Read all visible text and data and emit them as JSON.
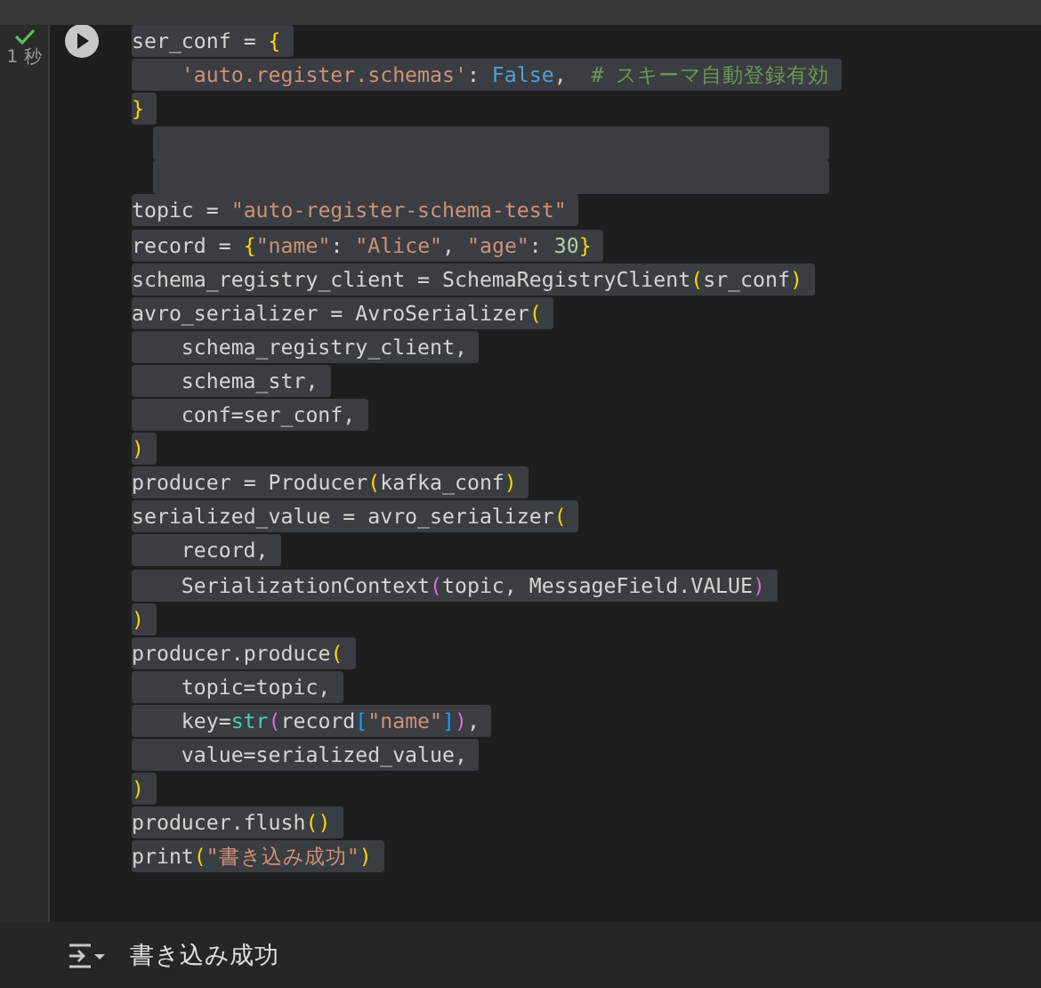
{
  "cell": {
    "status": {
      "done": true,
      "time": "1 秒"
    },
    "lines": [
      {
        "tokens": [
          {
            "text": "ser_conf = ",
            "kind": "plain"
          },
          {
            "text": "{",
            "kind": "brace"
          }
        ]
      },
      {
        "indented": true,
        "tokens": [
          {
            "text": "'auto.register.schemas'",
            "kind": "string"
          },
          {
            "text": ": ",
            "kind": "plain"
          },
          {
            "text": "False",
            "kind": "keyword"
          },
          {
            "text": ",  ",
            "kind": "plain"
          },
          {
            "text": "# スキーマ自動登録有効",
            "kind": "comment"
          }
        ]
      },
      {
        "tokens": [
          {
            "text": "}",
            "kind": "brace"
          }
        ]
      },
      {
        "kind": "blank"
      },
      {
        "kind": "blank"
      },
      {
        "tokens": [
          {
            "text": "topic = ",
            "kind": "plain"
          },
          {
            "text": "\"auto-register-schema-test\"",
            "kind": "string"
          }
        ]
      },
      {
        "tokens": [
          {
            "text": "record = ",
            "kind": "plain"
          },
          {
            "text": "{",
            "kind": "brace"
          },
          {
            "text": "\"name\"",
            "kind": "string"
          },
          {
            "text": ": ",
            "kind": "plain"
          },
          {
            "text": "\"Alice\"",
            "kind": "string"
          },
          {
            "text": ", ",
            "kind": "plain"
          },
          {
            "text": "\"age\"",
            "kind": "string"
          },
          {
            "text": ": ",
            "kind": "plain"
          },
          {
            "text": "30",
            "kind": "number"
          },
          {
            "text": "}",
            "kind": "brace"
          }
        ]
      },
      {
        "tokens": [
          {
            "text": "schema_registry_client = SchemaRegistryClient",
            "kind": "plain"
          },
          {
            "text": "(",
            "kind": "brace"
          },
          {
            "text": "sr_conf",
            "kind": "plain"
          },
          {
            "text": ")",
            "kind": "brace"
          }
        ]
      },
      {
        "tokens": [
          {
            "text": "avro_serializer = AvroSerializer",
            "kind": "plain"
          },
          {
            "text": "(",
            "kind": "brace"
          }
        ]
      },
      {
        "indented": true,
        "tokens": [
          {
            "text": "schema_registry_client,",
            "kind": "plain"
          }
        ]
      },
      {
        "indented": true,
        "tokens": [
          {
            "text": "schema_str,",
            "kind": "plain"
          }
        ]
      },
      {
        "indented": true,
        "tokens": [
          {
            "text": "conf=ser_conf,",
            "kind": "plain"
          }
        ]
      },
      {
        "tokens": [
          {
            "text": ")",
            "kind": "brace"
          }
        ]
      },
      {
        "tokens": [
          {
            "text": "producer = Producer",
            "kind": "plain"
          },
          {
            "text": "(",
            "kind": "brace"
          },
          {
            "text": "kafka_conf",
            "kind": "plain"
          },
          {
            "text": ")",
            "kind": "brace"
          }
        ]
      },
      {
        "tokens": [
          {
            "text": "serialized_value = avro_serializer",
            "kind": "plain"
          },
          {
            "text": "(",
            "kind": "brace"
          }
        ]
      },
      {
        "indented": true,
        "tokens": [
          {
            "text": "record,",
            "kind": "plain"
          }
        ]
      },
      {
        "indented": true,
        "tokens": [
          {
            "text": "SerializationContext",
            "kind": "plain"
          },
          {
            "text": "(",
            "kind": "paren2"
          },
          {
            "text": "topic, MessageField.VALUE",
            "kind": "plain"
          },
          {
            "text": ")",
            "kind": "paren2"
          }
        ]
      },
      {
        "tokens": [
          {
            "text": ")",
            "kind": "brace"
          }
        ]
      },
      {
        "tokens": [
          {
            "text": "producer.produce",
            "kind": "plain"
          },
          {
            "text": "(",
            "kind": "brace"
          }
        ]
      },
      {
        "indented": true,
        "tokens": [
          {
            "text": "topic=topic,",
            "kind": "plain"
          }
        ]
      },
      {
        "indented": true,
        "tokens": [
          {
            "text": "key=",
            "kind": "plain"
          },
          {
            "text": "str",
            "kind": "builtin"
          },
          {
            "text": "(",
            "kind": "paren2"
          },
          {
            "text": "record",
            "kind": "plain"
          },
          {
            "text": "[",
            "kind": "paren3"
          },
          {
            "text": "\"name\"",
            "kind": "string"
          },
          {
            "text": "]",
            "kind": "paren3"
          },
          {
            "text": ")",
            "kind": "paren2"
          },
          {
            "text": ",",
            "kind": "plain"
          }
        ]
      },
      {
        "indented": true,
        "tokens": [
          {
            "text": "value=serialized_value,",
            "kind": "plain"
          }
        ]
      },
      {
        "tokens": [
          {
            "text": ")",
            "kind": "brace"
          }
        ]
      },
      {
        "tokens": [
          {
            "text": "producer.flush",
            "kind": "plain"
          },
          {
            "text": "()",
            "kind": "brace"
          }
        ]
      },
      {
        "tokens": [
          {
            "text": "print",
            "kind": "plain"
          },
          {
            "text": "(",
            "kind": "brace"
          },
          {
            "text": "\"書き込み成功\"",
            "kind": "string"
          },
          {
            "text": ")",
            "kind": "brace"
          }
        ]
      }
    ]
  },
  "output": {
    "text": "書き込み成功"
  }
}
